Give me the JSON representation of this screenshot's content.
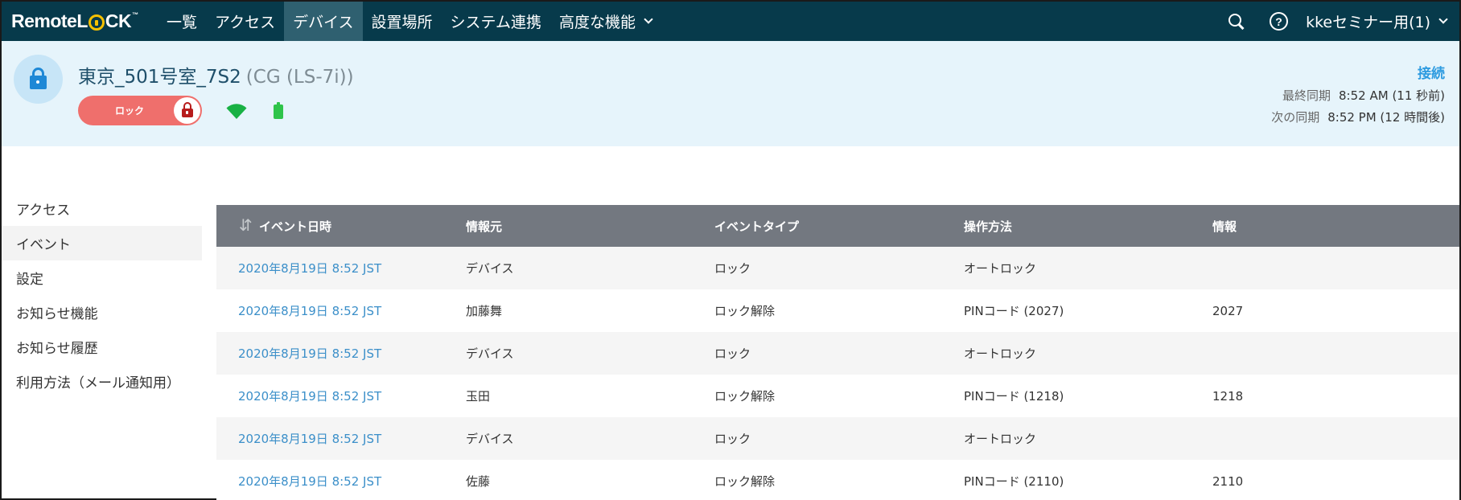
{
  "brand": {
    "text_before": "Remote",
    "text_after": "CK",
    "tm": "™"
  },
  "nav": {
    "items": [
      {
        "label": "一覧"
      },
      {
        "label": "アクセス"
      },
      {
        "label": "デバイス"
      },
      {
        "label": "設置場所"
      },
      {
        "label": "システム連携"
      },
      {
        "label": "高度な機能"
      }
    ],
    "active_index": 2,
    "user_label": "kkeセミナー用(1)"
  },
  "device": {
    "name": "東京_501号室_7S2",
    "model": "(CG (LS-7i))",
    "lock_label": "ロック",
    "connection_label": "接続",
    "last_sync_key": "最終同期",
    "last_sync_value": "8:52 AM (11 秒前)",
    "next_sync_key": "次の同期",
    "next_sync_value": "8:52 PM (12 時間後)",
    "status_color": "#ef6f6c",
    "wifi_color": "#18b144",
    "battery_color": "#2ec44a"
  },
  "sidebar": {
    "items": [
      {
        "label": "アクセス"
      },
      {
        "label": "イベント"
      },
      {
        "label": "設定"
      },
      {
        "label": "お知らせ機能"
      },
      {
        "label": "お知らせ履歴"
      },
      {
        "label": "利用方法（メール通知用）"
      }
    ],
    "active_index": 1
  },
  "table": {
    "headers": [
      "イベント日時",
      "情報元",
      "イベントタイプ",
      "操作方法",
      "情報"
    ],
    "rows": [
      [
        "2020年8月19日 8:52 JST",
        "デバイス",
        "ロック",
        "オートロック",
        ""
      ],
      [
        "2020年8月19日 8:52 JST",
        "加藤舞",
        "ロック解除",
        "PINコード (2027)",
        "2027"
      ],
      [
        "2020年8月19日 8:52 JST",
        "デバイス",
        "ロック",
        "オートロック",
        ""
      ],
      [
        "2020年8月19日 8:52 JST",
        "玉田",
        "ロック解除",
        "PINコード (1218)",
        "1218"
      ],
      [
        "2020年8月19日 8:52 JST",
        "デバイス",
        "ロック",
        "オートロック",
        ""
      ],
      [
        "2020年8月19日 8:52 JST",
        "佐藤",
        "ロック解除",
        "PINコード (2110)",
        "2110"
      ]
    ]
  }
}
